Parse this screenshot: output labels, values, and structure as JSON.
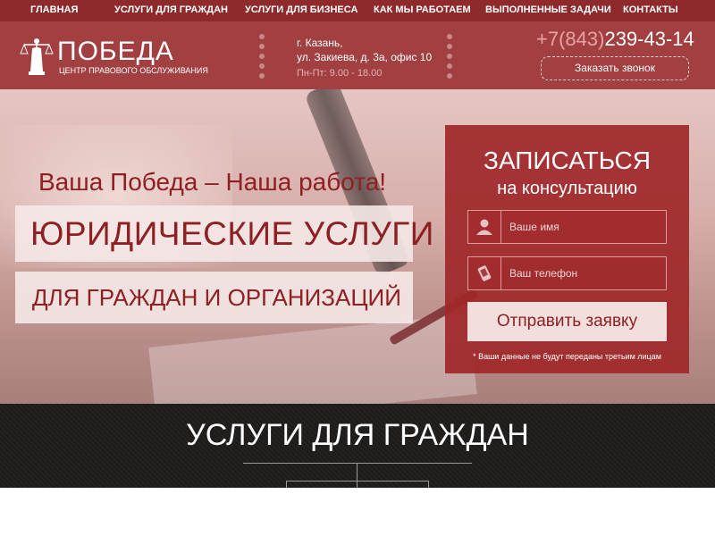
{
  "nav": {
    "items": [
      "Главная",
      "Услуги для граждан",
      "Услуги для бизнеса",
      "Как мы работаем",
      "Выполненные задачи",
      "Контакты"
    ]
  },
  "header": {
    "logo_title": "ПОБЕДА",
    "logo_subtitle": "ЦЕНТР ПРАВОВОГО ОБСЛУЖИВАНИЯ",
    "address_line1": "г. Казань,",
    "address_line2": "ул. Закиева, д. 3а, офис 10",
    "hours": "Пн-Пт: 9.00 - 18.00",
    "phone_code": "+7(843)",
    "phone_number": "239-43-14",
    "callback_label": "Заказать звонок"
  },
  "hero": {
    "slogan": "Ваша Победа – Наша работа!",
    "headline": "ЮРИДИЧЕСКИЕ УСЛУГИ",
    "subheadline": "ДЛЯ ГРАЖДАН И ОРГАНИЗАЦИЙ"
  },
  "form": {
    "title": "ЗАПИСАТЬСЯ",
    "subtitle": "на консультацию",
    "name_placeholder": "Ваше имя",
    "phone_placeholder": "Ваш телефон",
    "submit_label": "Отправить заявку",
    "note": "* Ваши данные не будут переданы третьим лицам",
    "icons": [
      "user-icon",
      "phone-icon"
    ]
  },
  "services": {
    "title": "УСЛУГИ ДЛЯ ГРАЖДАН"
  },
  "colors": {
    "nav": "#8e2a2c",
    "header": "#a23f41",
    "accent": "#8e1f22",
    "services_bg": "#1d1a1a"
  }
}
